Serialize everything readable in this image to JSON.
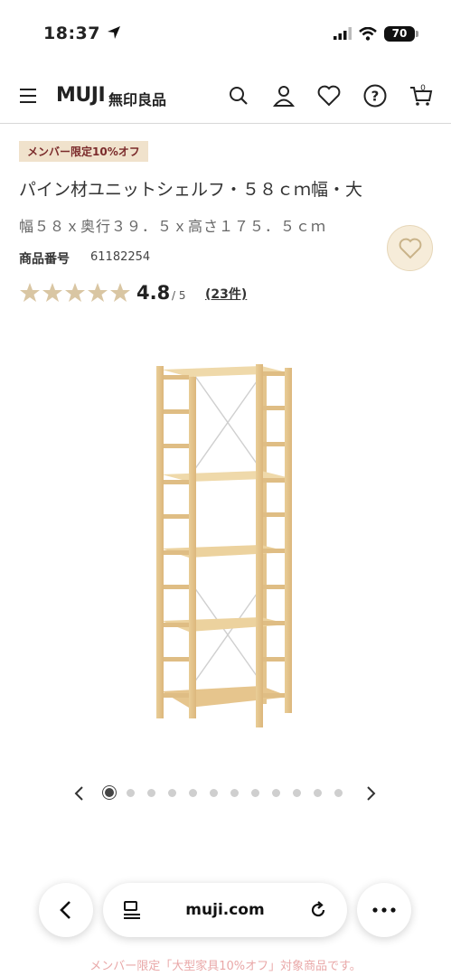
{
  "status_bar": {
    "time": "18:37",
    "battery": "70"
  },
  "header": {
    "logo_en": "MUJI",
    "logo_jp": "無印良品"
  },
  "product": {
    "badge": "メンバー限定10%オフ",
    "title": "パイン材ユニットシェルフ・５８ｃｍ幅・大",
    "subtitle": "幅５８ｘ奥行３９．５ｘ高さ１７５．５ｃｍ",
    "id_label": "商品番号",
    "id_value": "61182254",
    "rating": "4.8",
    "rating_max": "/ 5",
    "reviews": "(23件)",
    "stars": 5
  },
  "carousel": {
    "total_dots": 12,
    "active_index": 0
  },
  "browser": {
    "url": "muji.com"
  },
  "promo_text": "メンバー限定「大型家具10%オフ」対象商品です。",
  "colors": {
    "badge_bg": "#f0e2cc",
    "badge_text": "#7b2b2b",
    "star": "#d9c6a3",
    "fav_bg": "#f6ecd9",
    "promo": "#e9a8a8"
  }
}
